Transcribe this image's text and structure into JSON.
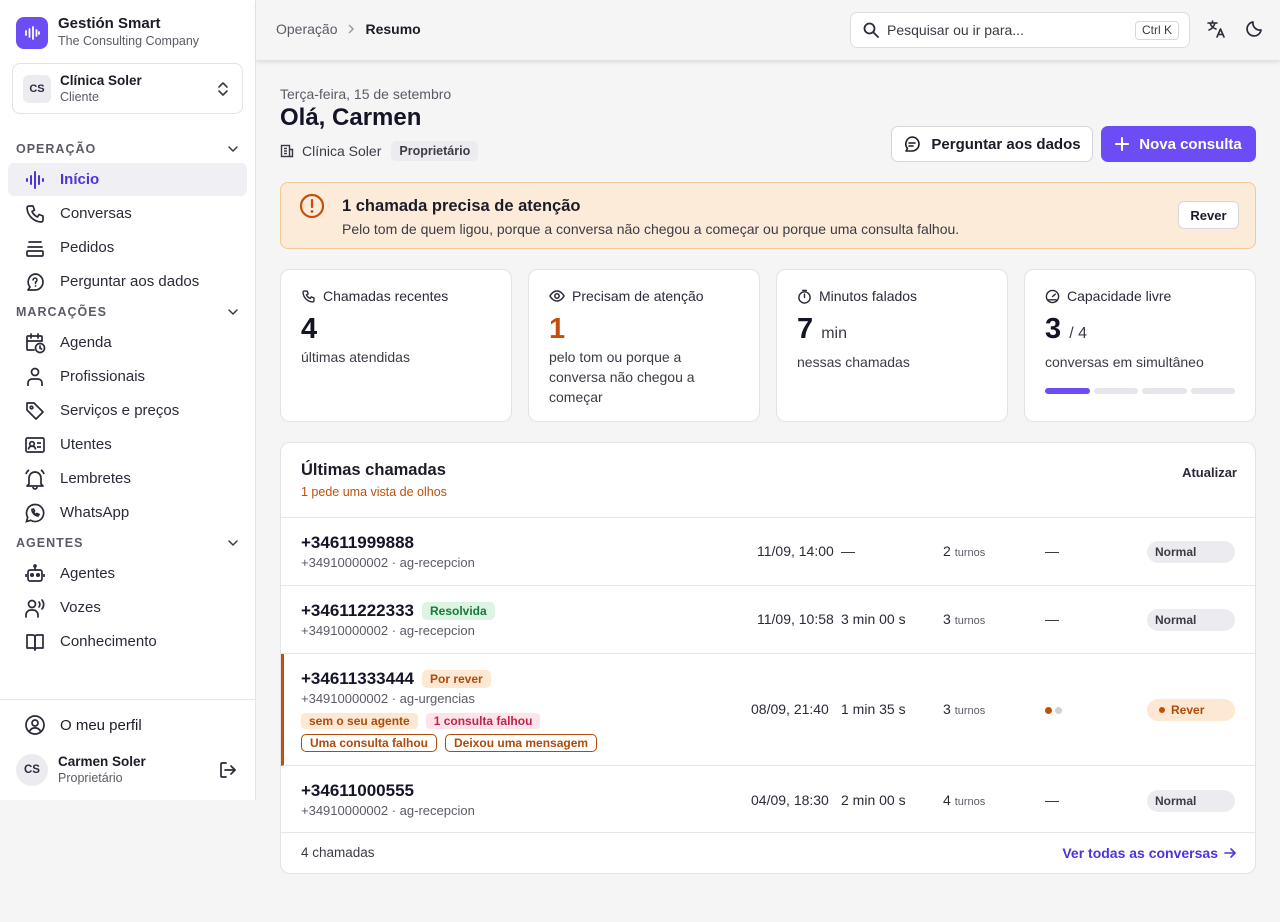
{
  "brand": {
    "name": "Gestión Smart",
    "subtitle": "The Consulting Company"
  },
  "client": {
    "initials": "CS",
    "name": "Clínica Soler",
    "role": "Cliente"
  },
  "nav": {
    "sections": [
      {
        "label": "OPERAÇÃO",
        "items": [
          "Início",
          "Conversas",
          "Pedidos",
          "Perguntar aos dados"
        ]
      },
      {
        "label": "MARCAÇÕES",
        "items": [
          "Agenda",
          "Profissionais",
          "Serviços e preços",
          "Utentes",
          "Lembretes",
          "WhatsApp"
        ]
      },
      {
        "label": "AGENTES",
        "items": [
          "Agentes",
          "Vozes",
          "Conhecimento"
        ]
      }
    ],
    "active": "Início"
  },
  "profile": {
    "link": "O meu perfil",
    "initials": "CS",
    "name": "Carmen Soler",
    "role": "Proprietário"
  },
  "topbar": {
    "breadcrumb": [
      "Operação",
      "Resumo"
    ],
    "search_placeholder": "Pesquisar ou ir para...",
    "shortcut": "Ctrl K"
  },
  "header": {
    "date": "Terça-feira, 15 de setembro",
    "greeting": "Olá, Carmen",
    "clinic": "Clínica Soler",
    "badge": "Proprietário",
    "ask_button": "Perguntar aos dados",
    "new_button": "Nova consulta"
  },
  "alert": {
    "title": "1 chamada precisa de atenção",
    "description": "Pelo tom de quem ligou, porque a conversa não chegou a começar ou porque uma consulta falhou.",
    "button": "Rever"
  },
  "stats": [
    {
      "label": "Chamadas recentes",
      "value": "4",
      "unit": "",
      "sub": "últimas atendidas",
      "icon": "phone-icon"
    },
    {
      "label": "Precisam de atenção",
      "value": "1",
      "unit": "",
      "sub": "pelo tom ou porque a conversa não chegou a começar",
      "icon": "eye-icon"
    },
    {
      "label": "Minutos falados",
      "value": "7",
      "unit": "min",
      "sub": "nessas chamadas",
      "icon": "timer-icon"
    },
    {
      "label": "Capacidade livre",
      "value": "3",
      "unit": "/ 4",
      "sub": "conversas em simultâneo",
      "icon": "gauge-icon"
    }
  ],
  "capacity": {
    "used": 1,
    "total": 4
  },
  "calls": {
    "title": "Últimas chamadas",
    "subtitle": "1 pede uma vista de olhos",
    "refresh": "Atualizar",
    "turns_word": "turnos",
    "rows": [
      {
        "number": "+34611999888",
        "meta": "+34910000002 · ag-recepcion",
        "tag": "",
        "date": "11/09, 14:00",
        "duration": "—",
        "turns": "2",
        "sentiment": "—",
        "status": "Normal"
      },
      {
        "number": "+34611222333",
        "meta": "+34910000002 · ag-recepcion",
        "tag": "Resolvida",
        "date": "11/09, 10:58",
        "duration": "3 min 00 s",
        "turns": "3",
        "sentiment": "—",
        "status": "Normal"
      },
      {
        "number": "+34611333444",
        "meta": "+34910000002 · ag-urgencias",
        "tag": "Por rever",
        "date": "08/09, 21:40",
        "duration": "1 min 35 s",
        "turns": "3",
        "sentiment": "",
        "status": "Rever",
        "chips": [
          "sem o seu agente",
          "1 consulta falhou",
          "Uma consulta falhou",
          "Deixou uma mensagem"
        ]
      },
      {
        "number": "+34611000555",
        "meta": "+34910000002 · ag-recepcion",
        "tag": "",
        "date": "04/09, 18:30",
        "duration": "2 min 00 s",
        "turns": "4",
        "sentiment": "—",
        "status": "Normal"
      }
    ],
    "footer_count": "4 chamadas",
    "footer_link": "Ver todas as conversas"
  },
  "colors": {
    "accent": "#6d4cf5",
    "warning": "#c2500a",
    "success": "#17783a"
  }
}
